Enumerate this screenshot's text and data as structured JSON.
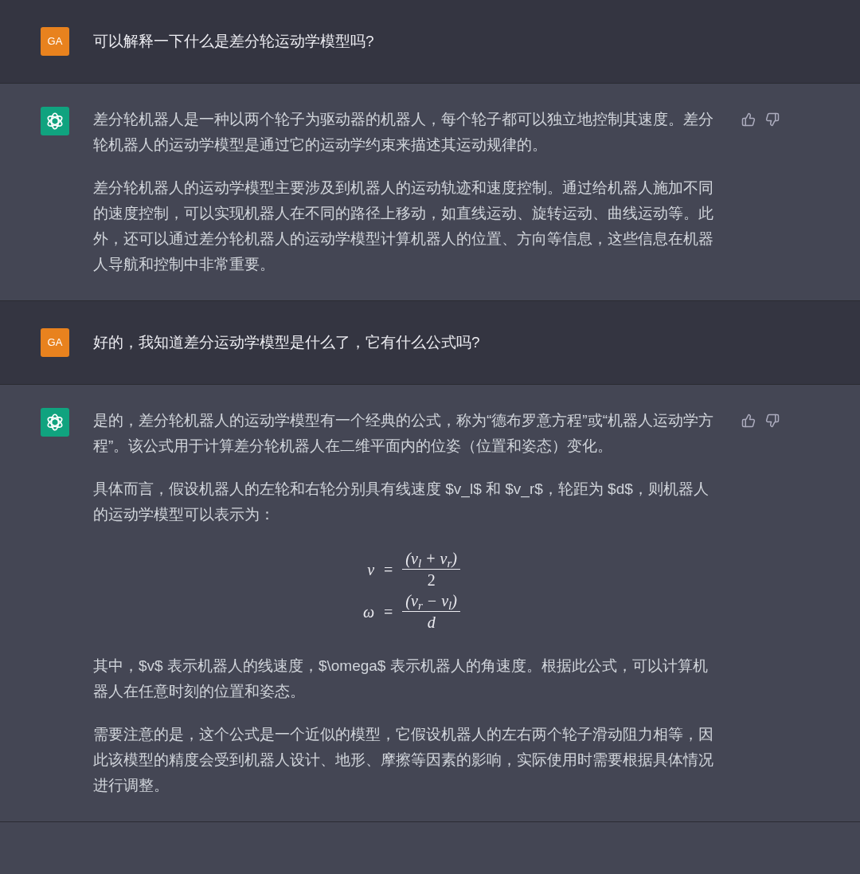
{
  "messages": [
    {
      "kind": "user",
      "avatar": "GA",
      "text": "可以解释一下什么是差分轮运动学模型吗?"
    },
    {
      "kind": "assistant",
      "blocks": [
        {
          "kind": "text",
          "text": "差分轮机器人是一种以两个轮子为驱动器的机器人，每个轮子都可以独立地控制其速度。差分轮机器人的运动学模型是通过它的运动学约束来描述其运动规律的。"
        },
        {
          "kind": "text",
          "text": "差分轮机器人的运动学模型主要涉及到机器人的运动轨迹和速度控制。通过给机器人施加不同的速度控制，可以实现机器人在不同的路径上移动，如直线运动、旋转运动、曲线运动等。此外，还可以通过差分轮机器人的运动学模型计算机器人的位置、方向等信息，这些信息在机器人导航和控制中非常重要。"
        }
      ]
    },
    {
      "kind": "user",
      "avatar": "GA",
      "text": "好的，我知道差分运动学模型是什么了，它有什么公式吗?"
    },
    {
      "kind": "assistant",
      "blocks": [
        {
          "kind": "text",
          "text": "是的，差分轮机器人的运动学模型有一个经典的公式，称为“德布罗意方程”或“机器人运动学方程”。该公式用于计算差分轮机器人在二维平面内的位姿（位置和姿态）变化。"
        },
        {
          "kind": "text",
          "text": "具体而言，假设机器人的左轮和右轮分别具有线速度 $v_l$ 和 $v_r$，轮距为 $d$，则机器人的运动学模型可以表示为："
        },
        {
          "kind": "equations",
          "rows": [
            {
              "lhs": "v",
              "equals": "=",
              "numerator": "(v$_{l}$ + v$_{r}$)",
              "denominator": "2"
            },
            {
              "lhs": "ω",
              "equals": "=",
              "numerator": "(v$_{r}$ − v$_{l}$)",
              "denominator": "d"
            }
          ]
        },
        {
          "kind": "text",
          "text": "其中，$v$ 表示机器人的线速度，$\\omega$ 表示机器人的角速度。根据此公式，可以计算机器人在任意时刻的位置和姿态。"
        },
        {
          "kind": "text",
          "text": "需要注意的是，这个公式是一个近似的模型，它假设机器人的左右两个轮子滑动阻力相等，因此该模型的精度会受到机器人设计、地形、摩擦等因素的影响，实际使用时需要根据具体情况进行调整。"
        }
      ]
    }
  ]
}
